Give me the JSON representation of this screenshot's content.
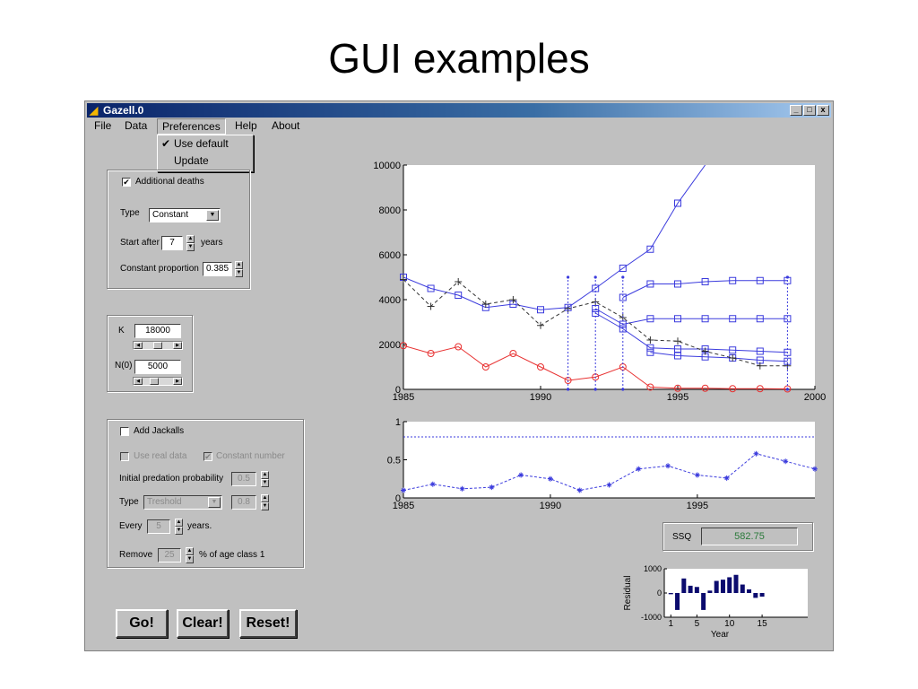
{
  "slide": {
    "title": "GUI examples"
  },
  "window": {
    "title": "Gazell.0",
    "min": "_",
    "max": "□",
    "close": "x"
  },
  "menu": {
    "file": "File",
    "data": "Data",
    "preferences": "Preferences",
    "help": "Help",
    "about": "About"
  },
  "prefs_menu": {
    "check": "✔",
    "use_default": "Use default",
    "update": "Update"
  },
  "deaths": {
    "checkbox_label": "Additional deaths",
    "checked": "✔",
    "type_label": "Type",
    "type_value": "Constant",
    "start_label": "Start after",
    "start_value": "7",
    "start_unit": "years",
    "prop_label": "Constant proportion",
    "prop_value": "0.385"
  },
  "params": {
    "k_label": "K",
    "k_value": "18000",
    "n0_label": "N(0)",
    "n0_value": "5000"
  },
  "jackals": {
    "add_label": "Add Jackalls",
    "use_real_label": "Use real data",
    "constant_label": "Constant number",
    "constant_check": "✔",
    "pred_label": "Initial predation probability",
    "pred_value": "0.5",
    "type_label": "Type",
    "type_value": "Treshold",
    "type_value2": "0.8",
    "every_label": "Every",
    "every_value": "5",
    "every_unit": "years.",
    "remove_label": "Remove",
    "remove_value": "25",
    "remove_unit": "% of age class 1"
  },
  "buttons": {
    "go": "Go!",
    "clear": "Clear!",
    "reset": "Reset!"
  },
  "ssq": {
    "label": "SSQ",
    "value": "582.75"
  },
  "colors": {
    "blue": "#3b3bdd",
    "red": "#e83232",
    "black": "#333333",
    "navy": "#0b0b6e",
    "ssq_green": "#2b7a3b"
  },
  "chart_data": [
    {
      "type": "line",
      "title": "",
      "xlabel": "",
      "ylabel": "",
      "xlim": [
        1985,
        2000
      ],
      "ylim": [
        0,
        10000
      ],
      "x_ticks": [
        "1985",
        "1990",
        "1995",
        "2000"
      ],
      "y_ticks": [
        "0",
        "2000",
        "4000",
        "6000",
        "8000",
        "10000"
      ],
      "grid": false,
      "series": [
        {
          "style": "blue-square",
          "x": [
            1985,
            1986,
            1987,
            1988,
            1989,
            1990,
            1991,
            1992,
            1993,
            1994,
            1995,
            1996
          ],
          "y": [
            5000,
            4500,
            4200,
            3650,
            3800,
            3550,
            3650,
            4500,
            5400,
            6250,
            8300,
            10000
          ]
        },
        {
          "style": "blue-square",
          "x": [
            1993,
            1994,
            1995,
            1996,
            1997,
            1998,
            1999
          ],
          "y": [
            4100,
            4700,
            4700,
            4800,
            4850,
            4850,
            4850
          ]
        },
        {
          "style": "blue-square",
          "x": [
            1992,
            1993,
            1994,
            1995,
            1996,
            1997,
            1998,
            1999
          ],
          "y": [
            3600,
            2900,
            3150,
            3150,
            3150,
            3150,
            3150,
            3150
          ]
        },
        {
          "style": "blue-square",
          "x": [
            1992,
            1993,
            1994,
            1995,
            1996,
            1997,
            1998,
            1999
          ],
          "y": [
            3400,
            2700,
            1850,
            1800,
            1800,
            1750,
            1700,
            1650
          ]
        },
        {
          "style": "blue-square",
          "x": [
            1994,
            1995,
            1996,
            1997,
            1998,
            1999
          ],
          "y": [
            1650,
            1500,
            1450,
            1400,
            1300,
            1250
          ]
        },
        {
          "style": "black-plus-dashed",
          "x": [
            1985,
            1986,
            1987,
            1988,
            1989,
            1990,
            1991,
            1992,
            1993,
            1994,
            1995,
            1996,
            1997,
            1998,
            1999
          ],
          "y": [
            4900,
            3700,
            4800,
            3800,
            4000,
            2850,
            3600,
            3900,
            3200,
            2200,
            2150,
            1700,
            1400,
            1050,
            1050
          ]
        },
        {
          "style": "red-circle",
          "x": [
            1985,
            1986,
            1987,
            1988,
            1989,
            1990,
            1991,
            1992,
            1993,
            1994,
            1995,
            1996,
            1997,
            1998,
            1999
          ],
          "y": [
            1950,
            1600,
            1900,
            1000,
            1600,
            1000,
            400,
            550,
            1000,
            100,
            50,
            50,
            30,
            30,
            20
          ]
        },
        {
          "style": "blue-vertical-dotted",
          "x": [
            1991,
            1992,
            1993,
            1999
          ],
          "y": [
            5000,
            5000,
            5000,
            5000
          ]
        }
      ]
    },
    {
      "type": "line",
      "title": "",
      "xlim": [
        1985,
        1999
      ],
      "ylim": [
        0,
        1
      ],
      "x_ticks": [
        "1985",
        "1990",
        "1995"
      ],
      "y_ticks": [
        "0",
        "0.5",
        "1"
      ],
      "hline": 0.8,
      "series": [
        {
          "style": "blue-star-dashed",
          "x": [
            1985,
            1986,
            1987,
            1988,
            1989,
            1990,
            1991,
            1992,
            1993,
            1994,
            1995,
            1996,
            1997,
            1998,
            1999
          ],
          "y": [
            0.1,
            0.18,
            0.12,
            0.14,
            0.3,
            0.25,
            0.1,
            0.17,
            0.38,
            0.42,
            0.3,
            0.26,
            0.58,
            0.48,
            0.38
          ]
        }
      ]
    },
    {
      "type": "bar",
      "title": "",
      "xlabel": "Year",
      "ylabel": "Residual",
      "xlim": [
        0,
        22
      ],
      "ylim": [
        -1000,
        1000
      ],
      "x_ticks": [
        "1",
        "5",
        "10",
        "15"
      ],
      "y_ticks": [
        "1000",
        "0",
        "-1000"
      ],
      "categories": [
        1,
        2,
        3,
        4,
        5,
        6,
        7,
        8,
        9,
        10,
        11,
        12,
        13,
        14,
        15
      ],
      "values": [
        -50,
        -700,
        600,
        300,
        250,
        -700,
        100,
        500,
        550,
        650,
        750,
        350,
        150,
        -200,
        -150
      ]
    }
  ]
}
